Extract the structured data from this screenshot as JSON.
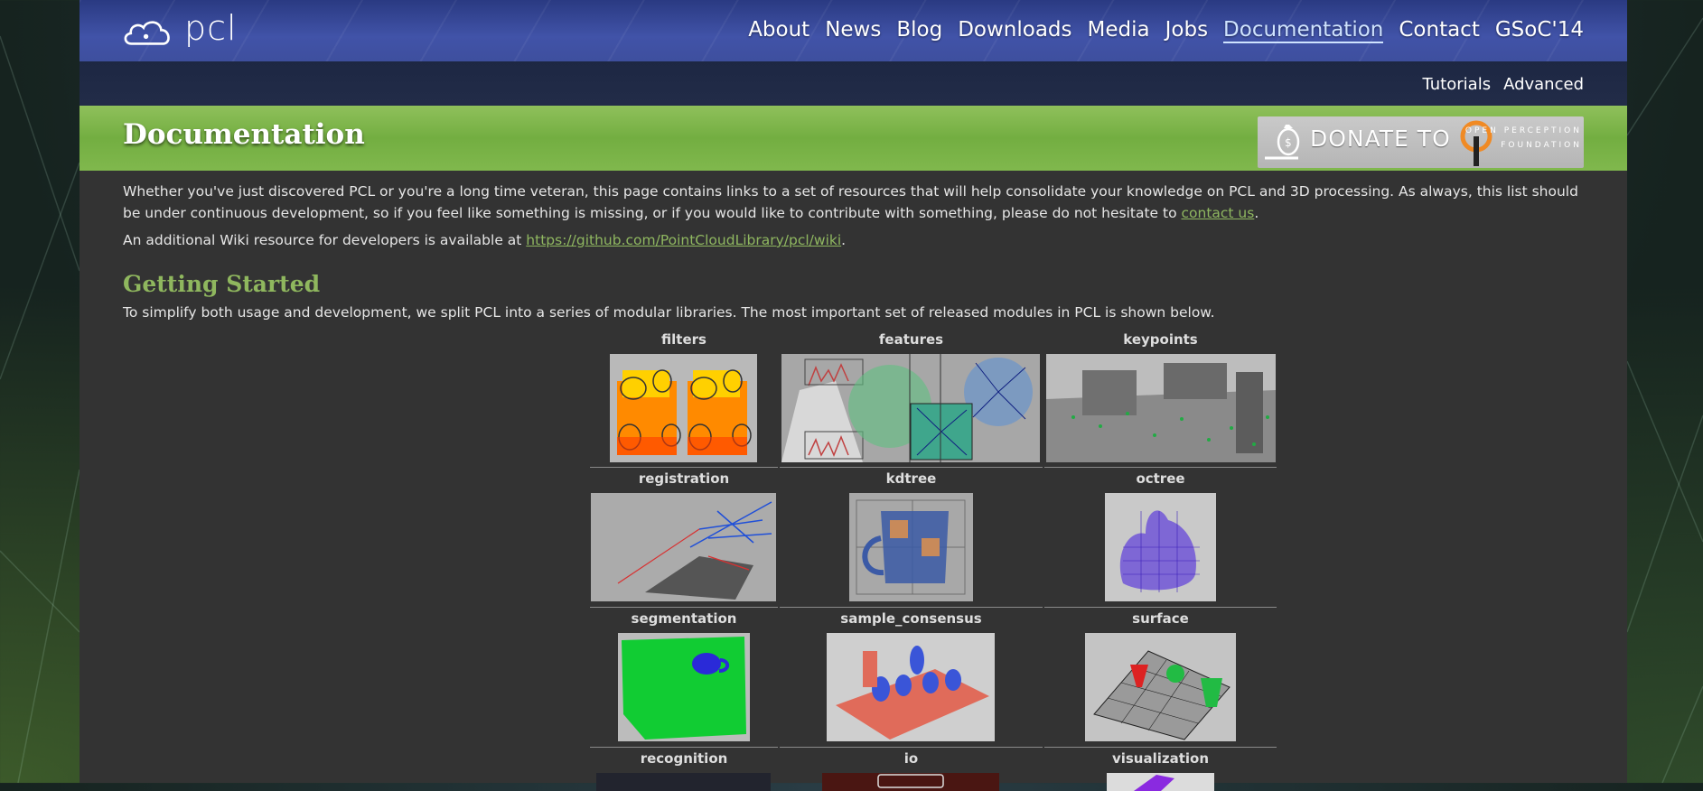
{
  "brand": {
    "logo_text": "pcl"
  },
  "nav": {
    "items": [
      "About",
      "News",
      "Blog",
      "Downloads",
      "Media",
      "Jobs",
      "Documentation",
      "Contact",
      "GSoC'14"
    ],
    "active": "Documentation"
  },
  "subnav": {
    "items": [
      "Tutorials",
      "Advanced"
    ]
  },
  "page": {
    "title": "Documentation",
    "donate_text": "DONATE TO",
    "donate_org_line1": "OPEN PERCEPTION",
    "donate_org_line2": "FOUNDATION"
  },
  "intro": {
    "p1_text": "Whether you've just discovered PCL or you're a long time veteran, this page contains links to a set of resources that will help consolidate your knowledge on PCL and 3D processing. As always, this list should be under continuous development, so if you feel like something is missing, or if you would like to contribute with something, please do not hesitate to ",
    "p1_link": "contact us",
    "p1_end": ".",
    "p2_text": "An additional Wiki resource for developers is available at ",
    "p2_link": "https://github.com/PointCloudLibrary/pcl/wiki",
    "p2_end": "."
  },
  "getting_started": {
    "heading": "Getting Started",
    "text": "To simplify both usage and development, we split PCL into a series of modular libraries. The most important set of released modules in PCL is shown below."
  },
  "modules": [
    [
      "filters",
      "features",
      "keypoints"
    ],
    [
      "registration",
      "kdtree",
      "octree"
    ],
    [
      "segmentation",
      "sample_consensus",
      "surface"
    ],
    [
      "recognition",
      "io",
      "visualization"
    ]
  ],
  "colors": {
    "nav_bg": "#3e4f9e",
    "title_bar": "#7ab347",
    "link": "#8fb760",
    "heading_green": "#8fb75e",
    "content_bg": "#333333"
  }
}
